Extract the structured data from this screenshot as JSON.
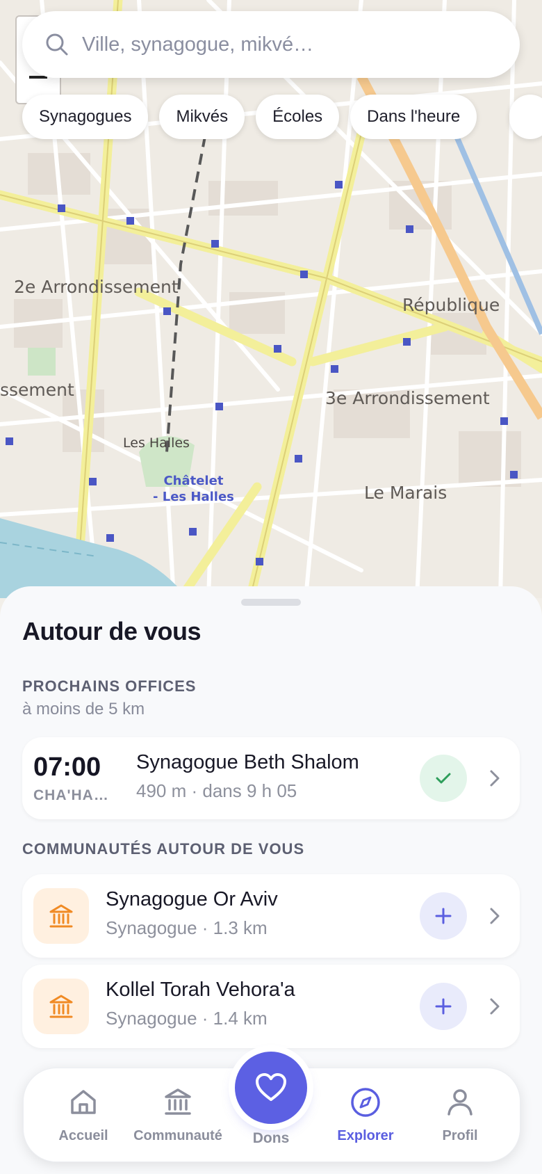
{
  "map": {
    "labels": {
      "arr2": "2e Arrondissement",
      "arr1_partial": "ssement",
      "republique": "République",
      "arr3": "3e Arrondissement",
      "halles": "Les Halles",
      "chatelet_line1": "Châtelet",
      "chatelet_line2": "- Les Halles",
      "marais": "Le Marais"
    }
  },
  "search": {
    "placeholder": "Ville, synagogue, mikvé…"
  },
  "chips": [
    "Synagogues",
    "Mikvés",
    "Écoles",
    "Dans l'heure"
  ],
  "sheet": {
    "title": "Autour de vous",
    "offices_label": "PROCHAINS OFFICES",
    "offices_sub": "à moins de 5 km",
    "office": {
      "time": "07:00",
      "time_sub": "CHA'HA…",
      "name": "Synagogue Beth Shalom",
      "detail": "490 m · dans 9 h 05"
    },
    "communities_label": "COMMUNAUTÉS AUTOUR DE VOUS",
    "communities": [
      {
        "name": "Synagogue Or Aviv",
        "detail": "Synagogue · 1.3 km"
      },
      {
        "name": "Kollel Torah Vehora'a",
        "detail": "Synagogue · 1.4 km"
      }
    ]
  },
  "nav": {
    "home": "Accueil",
    "community": "Communauté",
    "dons": "Dons",
    "explore": "Explorer",
    "profile": "Profil"
  },
  "colors": {
    "accent": "#5c60e3",
    "check_green": "#2e9e5b",
    "institution_orange": "#f08a24"
  }
}
